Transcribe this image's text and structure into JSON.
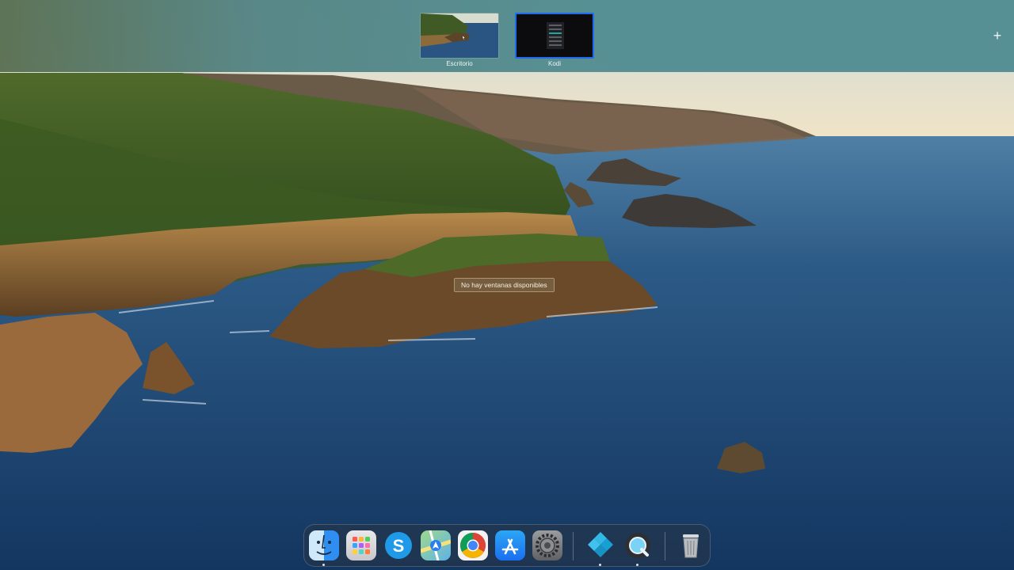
{
  "spaces": [
    {
      "label": "Escritorio"
    },
    {
      "label": "Kodi"
    }
  ],
  "add_space": "+",
  "tooltip": "No hay ventanas disponibles",
  "dock": {
    "apps": [
      {
        "name": "Finder",
        "icon": "finder-icon",
        "running": true
      },
      {
        "name": "Launchpad",
        "icon": "launchpad-icon",
        "running": false
      },
      {
        "name": "Skype",
        "icon": "skype-icon",
        "running": false
      },
      {
        "name": "Mapas",
        "icon": "maps-icon",
        "running": false
      },
      {
        "name": "Google Chrome",
        "icon": "chrome-icon",
        "running": false
      },
      {
        "name": "App Store",
        "icon": "app-store-icon",
        "running": false
      },
      {
        "name": "Preferencias del Sistema",
        "icon": "settings-gear-icon",
        "running": false
      },
      {
        "name": "Kodi",
        "icon": "kodi-icon",
        "running": true
      },
      {
        "name": "QuickTime Player",
        "icon": "quicktime-icon",
        "running": true
      },
      {
        "name": "Papelera",
        "icon": "trash-icon",
        "running": false
      }
    ],
    "skype_letter": "S"
  },
  "colors": {
    "spaces_bar": "#548e92",
    "selected_space_border": "#1e6bf0",
    "tooltip_bg": "#786040"
  }
}
